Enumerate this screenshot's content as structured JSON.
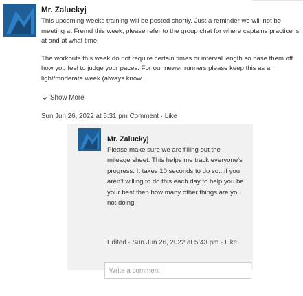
{
  "post": {
    "author": "Mr. Zaluckyj",
    "paragraphs": [
      "This upcoming weeks training will be posted shortly. Just a reminder we will not be meeting at Fremd this week, please refer to the group chat for where captains practice is at and at what time.",
      "The workouts this week do not require certain times or interval length so base them off how you feel to judge your paces. For our newer runners please keep this as a light/moderate week (always know..."
    ],
    "show_more": "Show More",
    "timestamp": "Sun Jun 26, 2022 at 5:31 pm",
    "comment_link": "Comment",
    "like_link": "Like",
    "separator": "·"
  },
  "reply": {
    "author": "Mr. Zaluckyj",
    "text": "Please make sure we are filling out the mileage sheet. This helps me track everyone's progress. It takes 10 seconds to do so...if you aren't willing to do this each day to help you be your best then how many other things are you not doing",
    "edited_label": "Edited",
    "timestamp": "Sun Jun 26, 2022 at 5:43 pm",
    "like_link": "Like",
    "separator": "·"
  },
  "comment_input": {
    "placeholder": "Write a comment",
    "value": ""
  },
  "colors": {
    "avatar_bg": "#1f5f97",
    "avatar_shape": "#2f7fc4",
    "reply_bg": "#f1f1f1"
  },
  "icons": {
    "avatar": "abstract-logo-icon",
    "show_more": "chevron-down-icon"
  }
}
